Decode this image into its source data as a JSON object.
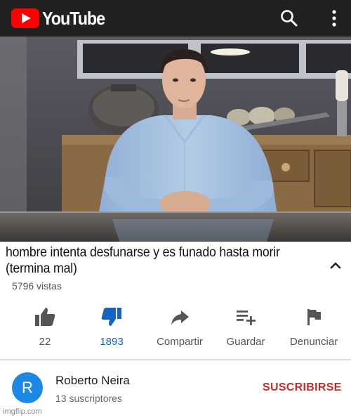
{
  "header": {
    "logo_text": "YouTube",
    "search_icon": "search-icon",
    "more_icon": "more-vertical-icon",
    "brand_color": "#ff0000",
    "bar_color": "#212121"
  },
  "video": {
    "title": "hombre intenta desfunarse y es funado hasta morir (termina mal)",
    "views": "5796 vistas",
    "collapse_icon": "chevron-up-icon"
  },
  "actions": [
    {
      "icon": "thumbs-up-icon",
      "label": "22"
    },
    {
      "icon": "thumbs-down-icon",
      "label": "1893",
      "active": true,
      "color": "#1565c0"
    },
    {
      "icon": "share-icon",
      "label": "Compartir"
    },
    {
      "icon": "playlist-add-icon",
      "label": "Guardar"
    },
    {
      "icon": "flag-icon",
      "label": "Denunciar"
    }
  ],
  "channel": {
    "avatar_letter": "R",
    "avatar_color": "#1e88e5",
    "name": "Roberto Neira",
    "subscribers": "13 suscriptores",
    "subscribe_label": "SUSCRIBIRSE",
    "subscribe_color": "#c0302a"
  },
  "watermark": "imgflip.com"
}
